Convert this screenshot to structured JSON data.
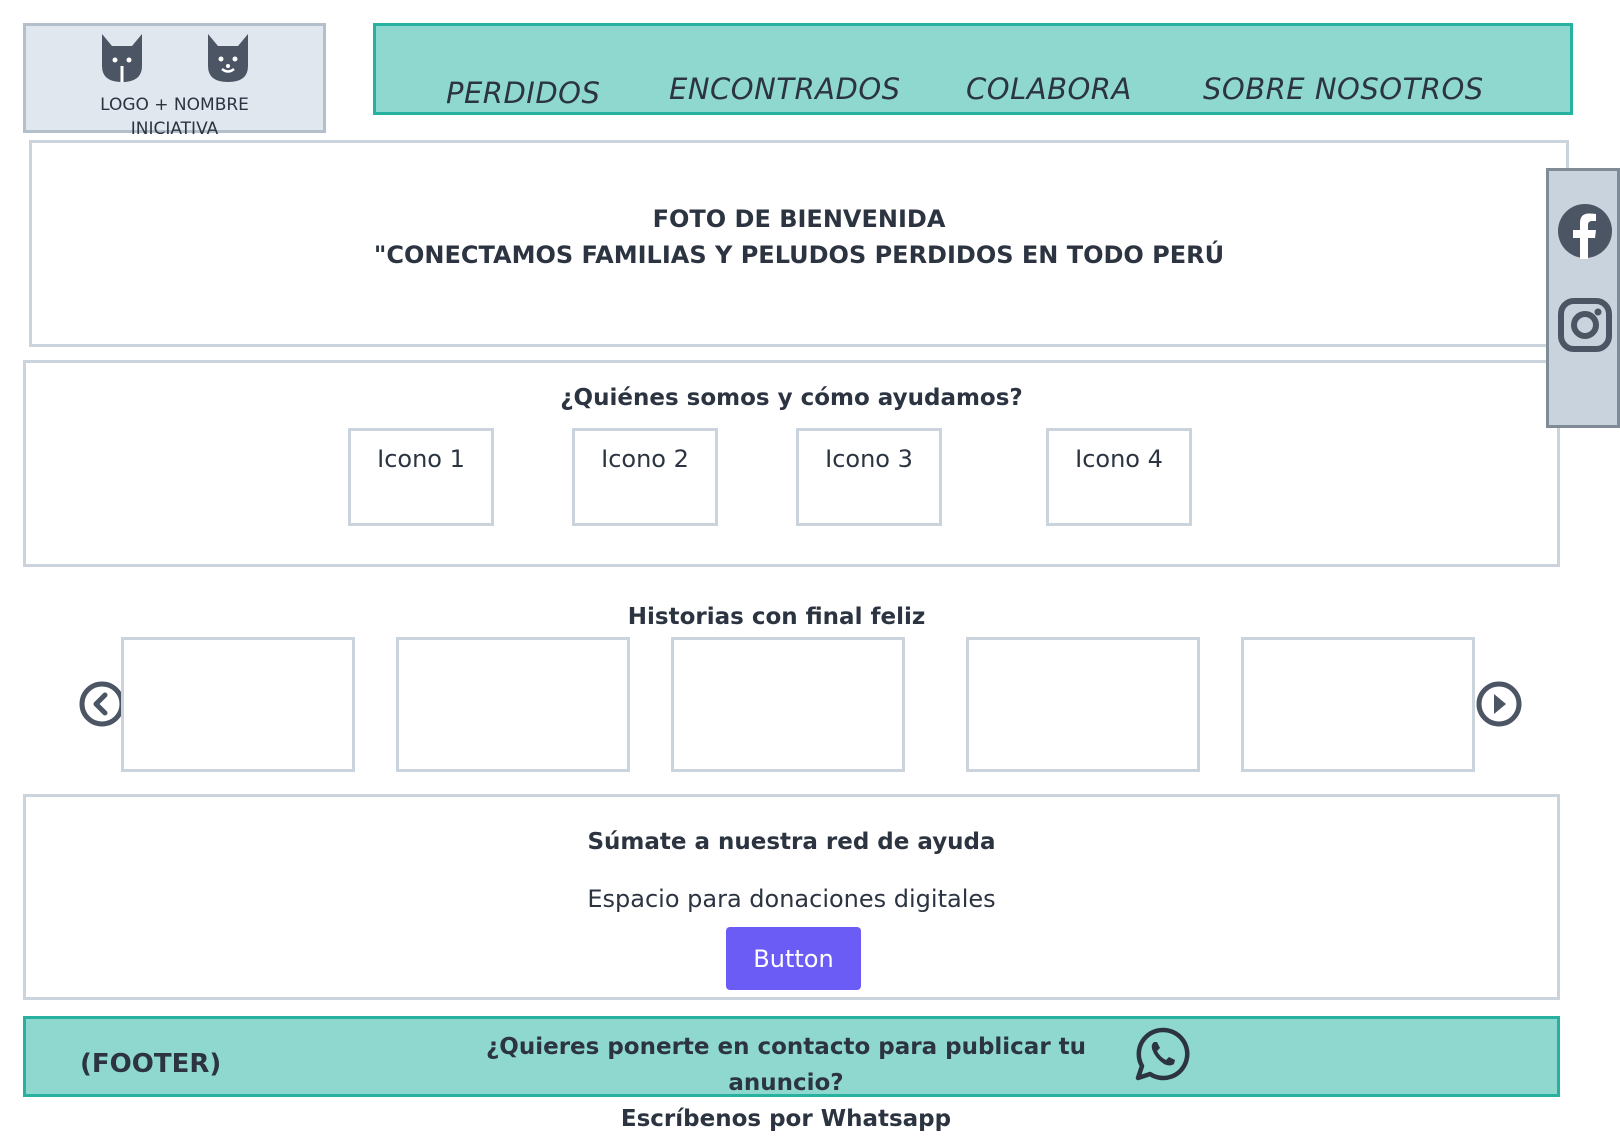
{
  "logo": {
    "text_line1": "LOGO + NOMBRE",
    "text_line2": "INICIATIVA",
    "icons": [
      "cat-icon",
      "cat-icon"
    ]
  },
  "nav": {
    "items": [
      "PERDIDOS",
      "ENCONTRADOS",
      "COLABORA",
      "SOBRE NOSOTROS"
    ]
  },
  "hero": {
    "line1": "FOTO DE BIENVENIDA",
    "line2": "\"CONECTAMOS FAMILIAS Y PELUDOS PERDIDOS EN TODO PERÚ"
  },
  "social": {
    "icons": [
      "facebook-icon",
      "instagram-icon"
    ]
  },
  "about": {
    "title": "¿Quiénes somos y cómo ayudamos?",
    "icons": [
      "Icono 1",
      "Icono 2",
      "Icono 3",
      "Icono 4"
    ]
  },
  "stories": {
    "title": "Historias con final feliz",
    "prev_icon": "chevron-left-circle-icon",
    "next_icon": "play-right-circle-icon"
  },
  "cta": {
    "title": "Súmate a nuestra red de ayuda",
    "subtitle": "Espacio para donaciones digitales",
    "button_label": "Button"
  },
  "footer": {
    "label": "(FOOTER)",
    "line1": "¿Quieres ponerte en contacto para publicar tu anuncio?",
    "line2": "Escríbenos por Whatsapp",
    "icon": "whatsapp-icon"
  },
  "colors": {
    "nav_bg": "#8fd8cf",
    "nav_border": "#27b29f",
    "button_bg": "#6b5cf6",
    "text": "#2b3440"
  }
}
